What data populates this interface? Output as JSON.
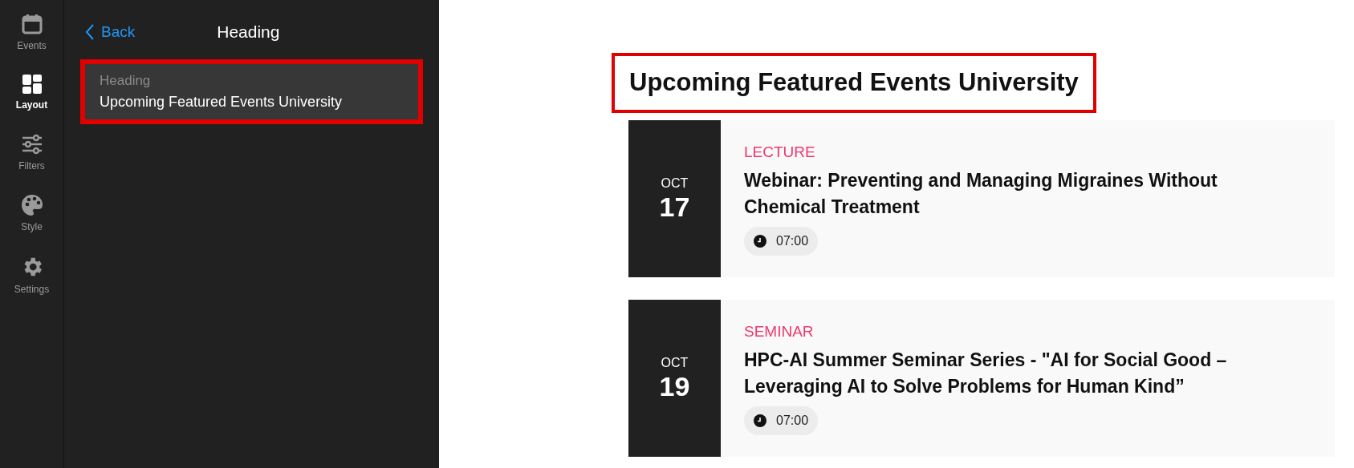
{
  "nav": [
    {
      "label": "Events",
      "selected": false
    },
    {
      "label": "Layout",
      "selected": true
    },
    {
      "label": "Filters",
      "selected": false
    },
    {
      "label": "Style",
      "selected": false
    },
    {
      "label": "Settings",
      "selected": false
    }
  ],
  "panel": {
    "back": "Back",
    "title": "Heading",
    "field": {
      "label": "Heading",
      "value": "Upcoming Featured Events University",
      "highlighted": true
    }
  },
  "main": {
    "heading": "Upcoming Featured Events University",
    "heading_highlighted": true,
    "events": [
      {
        "month": "OCT",
        "day": "17",
        "category": "LECTURE",
        "title": "Webinar: Preventing and Managing Migraines Without Chemical Treatment",
        "time": "07:00"
      },
      {
        "month": "OCT",
        "day": "19",
        "category": "SEMINAR",
        "title": "HPC-AI Summer Seminar Series - \"AI for Social Good – Leveraging AI to Solve Problems for Human Kind”",
        "time": "07:00"
      }
    ]
  }
}
